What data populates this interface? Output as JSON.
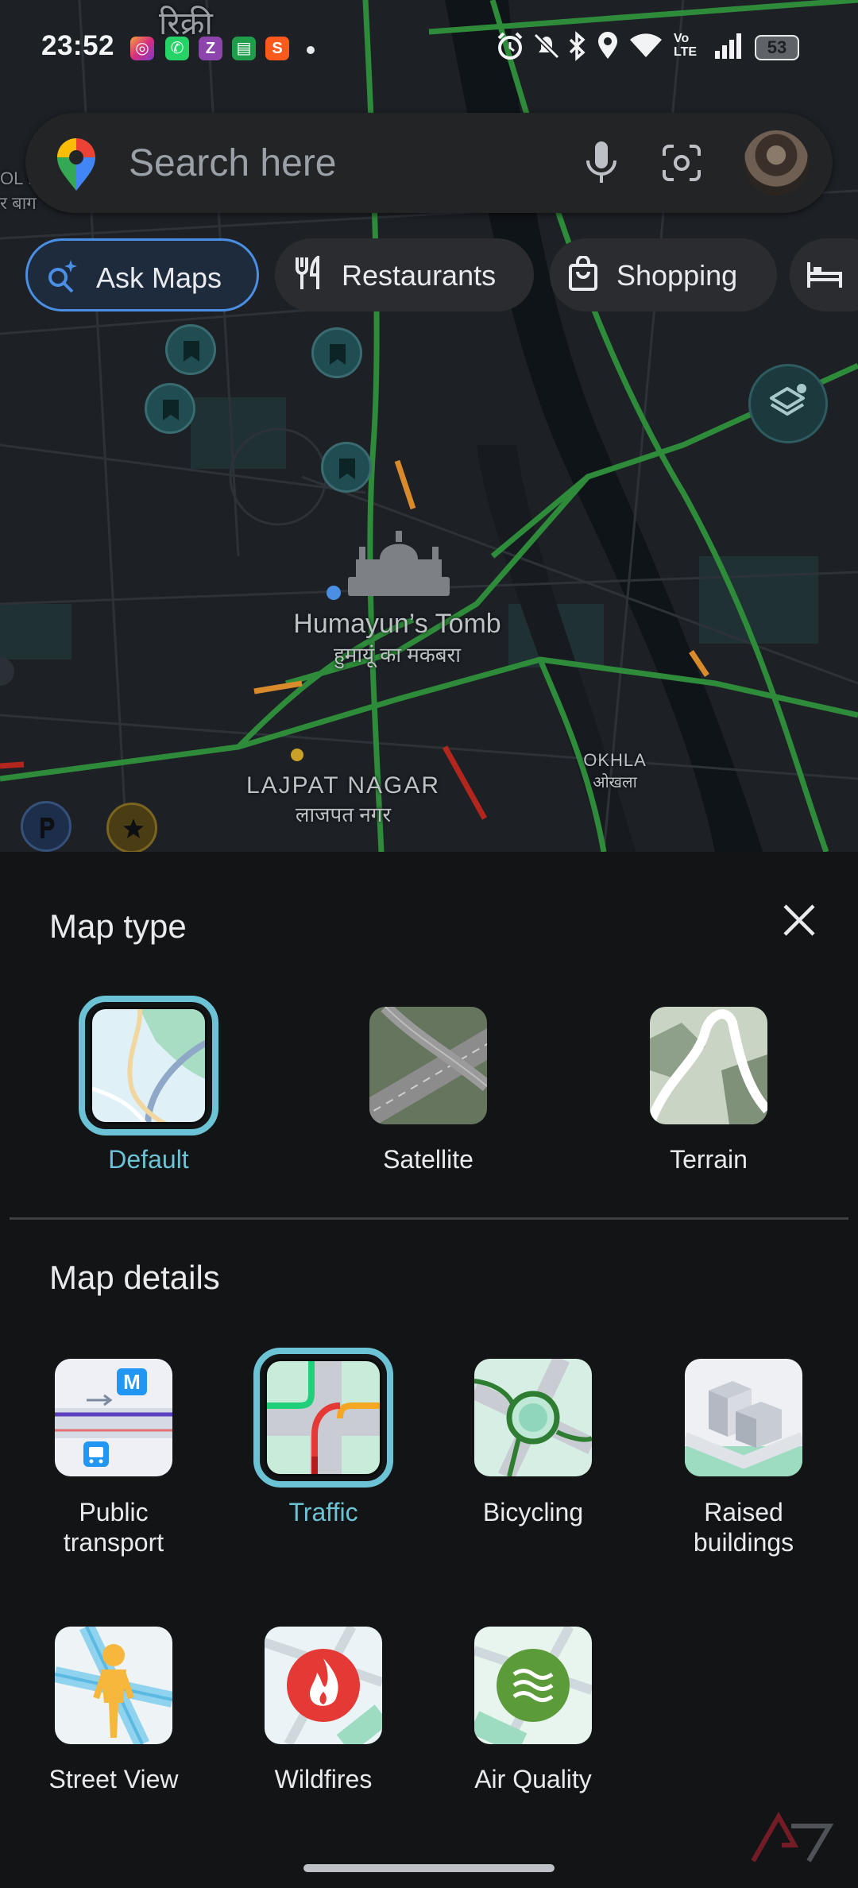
{
  "status_bar": {
    "time": "23:52",
    "notification_icons": [
      "instagram-icon",
      "whatsapp-icon",
      "zomato-icon",
      "google-chat-icon",
      "swiggy-icon"
    ],
    "system_icons": [
      "alarm-icon",
      "dnd-icon",
      "bluetooth-icon",
      "location-icon",
      "wifi-icon",
      "volte-icon",
      "signal-icon"
    ],
    "battery": "53"
  },
  "search": {
    "placeholder": "Search here"
  },
  "chips": [
    {
      "label": "Ask Maps",
      "icon": "sparkle-search-icon",
      "active": true
    },
    {
      "label": "Restaurants",
      "icon": "fork-knife-icon",
      "active": false
    },
    {
      "label": "Shopping",
      "icon": "shopping-bag-icon",
      "active": false
    },
    {
      "label": "",
      "icon": "hotel-bed-icon",
      "active": false
    }
  ],
  "map": {
    "landmark_en": "Humayun’s Tomb",
    "landmark_hi": "हुमायूं का मकबरा",
    "area1_en": "LAJPAT NAGAR",
    "area1_hi": "लाजपत नगर",
    "area2_en": "OKHLA",
    "area2_hi": "ओखला",
    "top_fragment": "रिक्री",
    "edge_left": "OL I",
    "edge_left2": "र बाग"
  },
  "sheet": {
    "map_type_title": "Map type",
    "map_types": [
      {
        "label": "Default",
        "selected": true
      },
      {
        "label": "Satellite",
        "selected": false
      },
      {
        "label": "Terrain",
        "selected": false
      }
    ],
    "map_details_title": "Map details",
    "map_details": [
      {
        "label": "Public transport",
        "line1": "Public",
        "line2": "transport",
        "selected": false
      },
      {
        "label": "Traffic",
        "line1": "Traffic",
        "line2": "",
        "selected": true
      },
      {
        "label": "Bicycling",
        "line1": "Bicycling",
        "line2": "",
        "selected": false
      },
      {
        "label": "Raised buildings",
        "line1": "Raised",
        "line2": "buildings",
        "selected": false
      },
      {
        "label": "Street View",
        "line1": "Street View",
        "line2": "",
        "selected": false
      },
      {
        "label": "Wildfires",
        "line1": "Wildfires",
        "line2": "",
        "selected": false
      },
      {
        "label": "Air Quality",
        "line1": "Air Quality",
        "line2": "",
        "selected": false
      }
    ]
  },
  "colors": {
    "accent": "#6cc3d6",
    "traffic_green": "#2e8b3a",
    "traffic_orange": "#d98a2b",
    "traffic_red": "#b3261e",
    "chip_active_border": "#4a8fe3"
  }
}
